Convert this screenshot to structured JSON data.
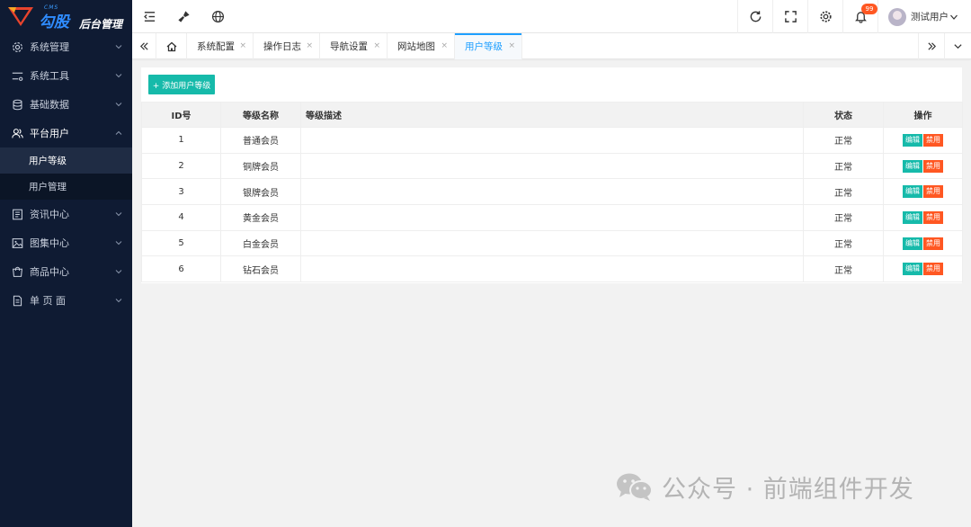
{
  "brand": {
    "cms": "CMS",
    "name": "勾股",
    "subtitle": "后台管理"
  },
  "sidebar": {
    "items": [
      {
        "label": "系统管理",
        "icon": "settings-icon"
      },
      {
        "label": "系统工具",
        "icon": "tools-icon"
      },
      {
        "label": "基础数据",
        "icon": "database-icon"
      },
      {
        "label": "平台用户",
        "icon": "users-icon",
        "open": true,
        "children": [
          {
            "label": "用户等级",
            "active": true
          },
          {
            "label": "用户管理"
          }
        ]
      },
      {
        "label": "资讯中心",
        "icon": "news-icon"
      },
      {
        "label": "图集中心",
        "icon": "image-icon"
      },
      {
        "label": "商品中心",
        "icon": "shop-icon"
      },
      {
        "label": "单 页 面",
        "icon": "page-icon"
      }
    ]
  },
  "topbar": {
    "notifications": "99",
    "user_name": "测试用户"
  },
  "tabs": [
    {
      "label": "系统配置"
    },
    {
      "label": "操作日志"
    },
    {
      "label": "导航设置"
    },
    {
      "label": "网站地图"
    },
    {
      "label": "用户等级",
      "active": true
    }
  ],
  "tab_close": "×",
  "content": {
    "add_button": "+ 添加用户等级",
    "columns": [
      "ID号",
      "等级名称",
      "等级描述",
      "状态",
      "操作"
    ],
    "rows": [
      {
        "id": "1",
        "name": "普通会员",
        "desc": "",
        "status": "正常"
      },
      {
        "id": "2",
        "name": "铜牌会员",
        "desc": "",
        "status": "正常"
      },
      {
        "id": "3",
        "name": "银牌会员",
        "desc": "",
        "status": "正常"
      },
      {
        "id": "4",
        "name": "黄金会员",
        "desc": "",
        "status": "正常"
      },
      {
        "id": "5",
        "name": "白金会员",
        "desc": "",
        "status": "正常"
      },
      {
        "id": "6",
        "name": "钻石会员",
        "desc": "",
        "status": "正常"
      }
    ],
    "edit_label": "编辑",
    "disable_label": "禁用"
  },
  "watermark": "公众号 · 前端组件开发",
  "colors": {
    "sidebar_bg": "#0f1b33",
    "accent": "#1e9fff",
    "teal": "#16baaa",
    "orange": "#ff5722"
  }
}
